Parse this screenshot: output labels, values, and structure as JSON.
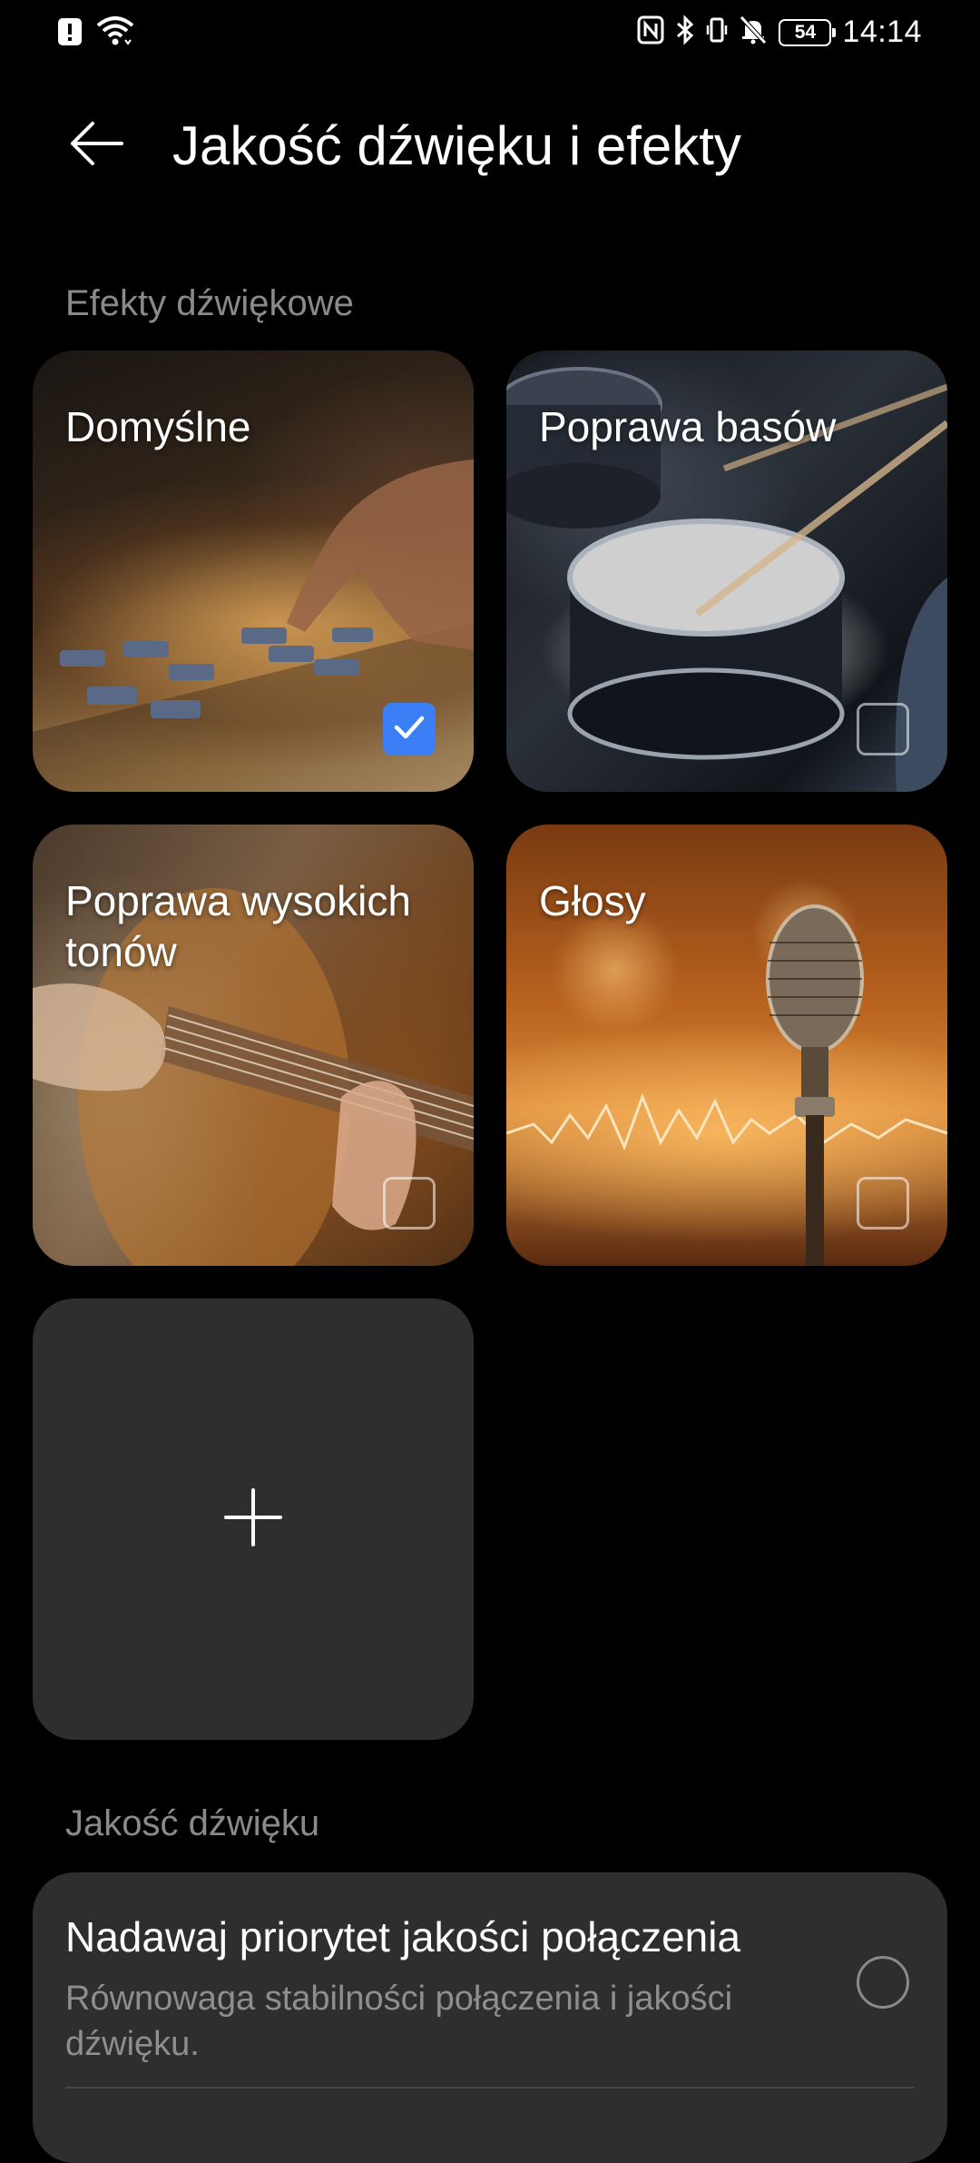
{
  "status_bar": {
    "time": "14:14",
    "battery": "54",
    "left_icons": [
      "alert-icon",
      "wifi-icon"
    ],
    "right_icons": [
      "nfc-icon",
      "bluetooth-icon",
      "vibrate-icon",
      "mute-icon"
    ]
  },
  "header": {
    "title": "Jakość dźwięku i efekty",
    "back_icon": "arrow-left-icon"
  },
  "sections": {
    "effects_label": "Efekty dźwiękowe",
    "quality_label": "Jakość dźwięku"
  },
  "effects": [
    {
      "label": "Domyślne",
      "checked": true
    },
    {
      "label": "Poprawa basów",
      "checked": false
    },
    {
      "label": "Poprawa wysokich tonów",
      "checked": false
    },
    {
      "label": "Głosy",
      "checked": false
    }
  ],
  "add_card": {
    "icon": "plus-icon"
  },
  "quality": {
    "title": "Nadawaj priorytet jakości połączenia",
    "description": "Równowaga stabilności połączenia i jakości dźwięku.",
    "selected": false
  },
  "colors": {
    "accent": "#3b7ef5",
    "card_bg": "#2e2e2e",
    "secondary_text": "#8a8a8a"
  }
}
